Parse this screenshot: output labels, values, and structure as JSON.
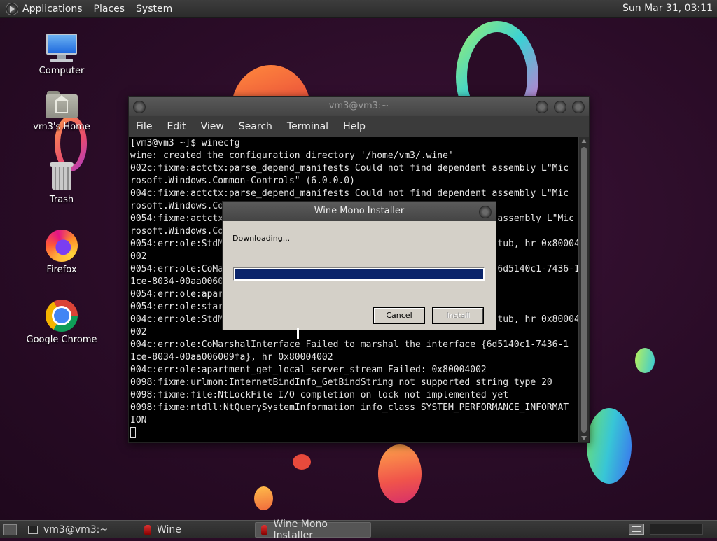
{
  "top_panel": {
    "menus": [
      "Applications",
      "Places",
      "System"
    ],
    "clock": "Sun Mar 31, 03:11"
  },
  "desktop_icons": [
    {
      "label": "Computer",
      "icon": "computer-icon"
    },
    {
      "label": "vm3's Home",
      "icon": "home-folder-icon"
    },
    {
      "label": "Trash",
      "icon": "trash-icon"
    },
    {
      "label": "Firefox",
      "icon": "firefox-icon"
    },
    {
      "label": "Google Chrome",
      "icon": "chrome-icon"
    }
  ],
  "terminal": {
    "title": "vm3@vm3:~",
    "menu": [
      "File",
      "Edit",
      "View",
      "Search",
      "Terminal",
      "Help"
    ],
    "lines": [
      "[vm3@vm3 ~]$ winecfg",
      "wine: created the configuration directory '/home/vm3/.wine'",
      "002c:fixme:actctx:parse_depend_manifests Could not find dependent assembly L\"Mic",
      "rosoft.Windows.Common-Controls\" (6.0.0.0)",
      "004c:fixme:actctx:parse_depend_manifests Could not find dependent assembly L\"Mic",
      "rosoft.Windows.Co",
      "0054:fixme:actctx                                                  assembly L\"Mic",
      "rosoft.Windows.Co",
      "0054:err:ole:StdM                                                  tub, hr 0x80004",
      "002",
      "0054:err:ole:CoMa                                                  6d5140c1-7436-1",
      "1ce-8034-00aa0060",
      "0054:err:ole:apar",
      "0054:err:ole:star",
      "004c:err:ole:StdM                                                  tub, hr 0x80004",
      "002",
      "004c:err:ole:CoMarshalInterface Failed to marshal the interface {6d5140c1-7436-1",
      "1ce-8034-00aa006009fa}, hr 0x80004002",
      "004c:err:ole:apartment_get_local_server_stream Failed: 0x80004002",
      "0098:fixme:urlmon:InternetBindInfo_GetBindString not supported string type 20",
      "0098:fixme:file:NtLockFile I/O completion on lock not implemented yet",
      "0098:fixme:ntdll:NtQuerySystemInformation info_class SYSTEM_PERFORMANCE_INFORMAT",
      "ION"
    ]
  },
  "dialog": {
    "title": "Wine Mono Installer",
    "status": "Downloading...",
    "progress": 1.0,
    "cancel_label": "Cancel",
    "install_label": "Install"
  },
  "taskbar": {
    "tasks": [
      {
        "label": "vm3@vm3:~",
        "icon": "terminal-icon"
      },
      {
        "label": "Wine",
        "icon": "wine-icon"
      },
      {
        "label": "Wine Mono Installer",
        "icon": "wine-icon"
      }
    ]
  }
}
